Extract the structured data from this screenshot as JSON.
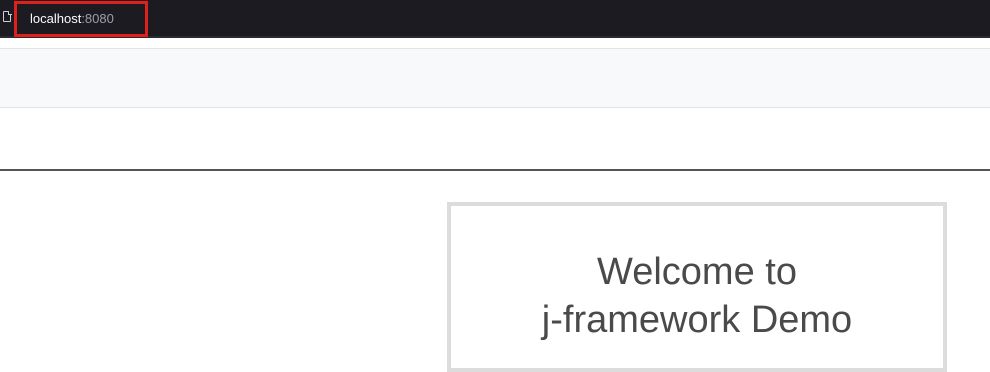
{
  "browser": {
    "url_host": "localhost",
    "url_port": ":8080"
  },
  "main": {
    "welcome_line1": "Welcome to",
    "welcome_line2": "j-framework Demo"
  },
  "colors": {
    "highlight": "#e0201d",
    "browser_bg": "#1c1b22"
  }
}
